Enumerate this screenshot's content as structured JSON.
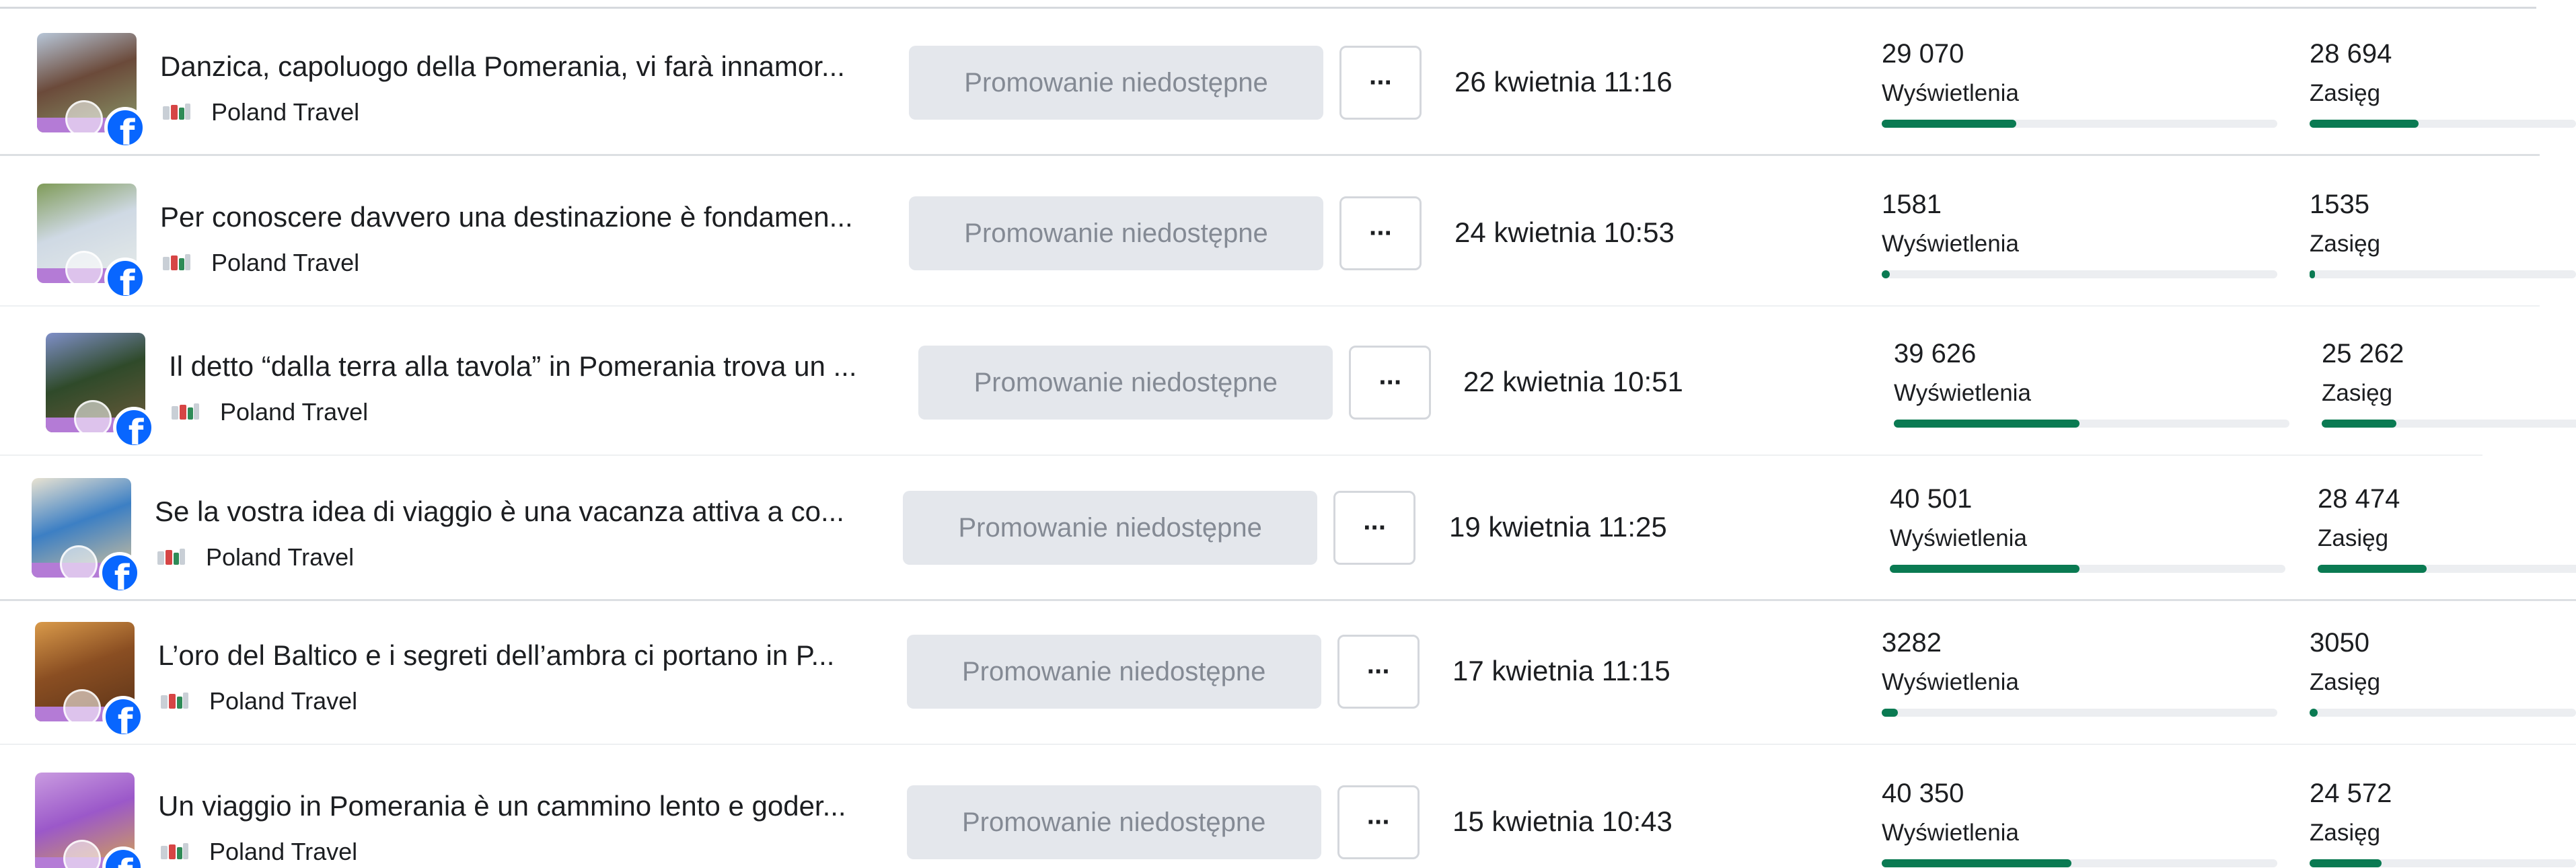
{
  "accent_fill": "#0a7a52",
  "facebook_blue": "#0866ff",
  "rows": [
    {
      "title": "Danzica, capoluogo della Pomerania, vi farà innamor...",
      "page": "Poland Travel",
      "platform_icon": "facebook-icon",
      "promo_label": "Promowanie niedostępne",
      "more_label": "···",
      "date": "26 kwietnia 11:16",
      "views": {
        "value": "29 070",
        "label": "Wyświetlenia",
        "fraction": 0.34
      },
      "reach": {
        "value": "28 694",
        "label": "Zasięg",
        "fraction": 0.41
      },
      "thumb_colors": [
        "#6b4a3a",
        "#b7c6d8",
        "#8a9a6a"
      ]
    },
    {
      "title": "Per conoscere davvero una destinazione è fondamen...",
      "page": "Poland Travel",
      "platform_icon": "facebook-icon",
      "promo_label": "Promowanie niedostępne",
      "more_label": "···",
      "date": "24 kwietnia 10:53",
      "views": {
        "value": "1581",
        "label": "Wyświetlenia",
        "fraction": 0.02
      },
      "reach": {
        "value": "1535",
        "label": "Zasięg",
        "fraction": 0.02
      },
      "thumb_colors": [
        "#cfd9e4",
        "#7f9b58",
        "#e7ece9"
      ]
    },
    {
      "title": "Il detto “dalla terra alla tavola” in Pomerania trova un ...",
      "page": "Poland Travel",
      "platform_icon": "facebook-icon",
      "promo_label": "Promowanie niedostępne",
      "more_label": "···",
      "date": "22 kwietnia 10:51",
      "views": {
        "value": "39 626",
        "label": "Wyświetlenia",
        "fraction": 0.47
      },
      "reach": {
        "value": "25 262",
        "label": "Zasięg",
        "fraction": 0.28
      },
      "thumb_colors": [
        "#2f4a2a",
        "#7f8fc8",
        "#6d5a3a"
      ]
    },
    {
      "title": "Se la vostra idea di viaggio è una vacanza attiva a co...",
      "page": "Poland Travel",
      "platform_icon": "facebook-icon",
      "promo_label": "Promowanie niedostępne",
      "more_label": "···",
      "date": "19 kwietnia 11:25",
      "views": {
        "value": "40 501",
        "label": "Wyświetlenia",
        "fraction": 0.48
      },
      "reach": {
        "value": "28 474",
        "label": "Zasięg",
        "fraction": 0.41
      },
      "thumb_colors": [
        "#3c7fc4",
        "#e9e3d2",
        "#d8c49a"
      ]
    },
    {
      "title": "L’oro del Baltico e i segreti dell’ambra ci portano in P...",
      "page": "Poland Travel",
      "platform_icon": "facebook-icon",
      "promo_label": "Promowanie niedostępne",
      "more_label": "···",
      "date": "17 kwietnia 11:15",
      "views": {
        "value": "3282",
        "label": "Wyświetlenia",
        "fraction": 0.04
      },
      "reach": {
        "value": "3050",
        "label": "Zasięg",
        "fraction": 0.03
      },
      "thumb_colors": [
        "#8a4e22",
        "#d99a4a",
        "#5a3318"
      ]
    },
    {
      "title": "Un viaggio in Pomerania è un cammino lento e goder...",
      "page": "Poland Travel",
      "platform_icon": "facebook-icon",
      "promo_label": "Promowanie niedostępne",
      "more_label": "···",
      "date": "15 kwietnia 10:43",
      "views": {
        "value": "40 350",
        "label": "Wyświetlenia",
        "fraction": 0.48
      },
      "reach": {
        "value": "24 572",
        "label": "Zasięg",
        "fraction": 0.27
      },
      "thumb_colors": [
        "#9b58c9",
        "#c99be0",
        "#d7a84a"
      ]
    }
  ]
}
